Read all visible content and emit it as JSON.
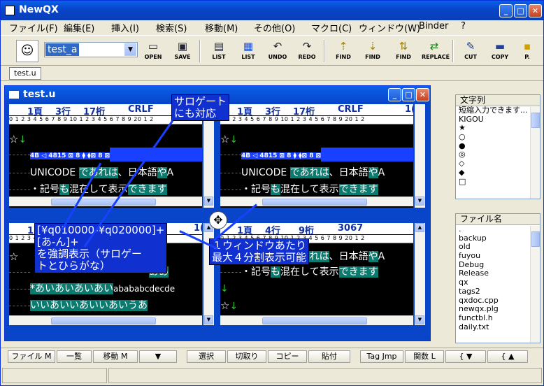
{
  "app": {
    "title": "NewQX"
  },
  "menu": [
    "ファイル(F)",
    "編集(E)",
    "挿入(I)",
    "検索(S)",
    "移動(M)",
    "その他(O)",
    "マクロ(C)",
    "ウィンドウ(W)",
    "Binder",
    "?"
  ],
  "toolbar": {
    "search_value": "test_a",
    "buttons": [
      {
        "label": "OPEN",
        "icon": "open-icon"
      },
      {
        "label": "SAVE",
        "icon": "save-icon"
      },
      {
        "label": "LIST",
        "icon": "list-icon"
      },
      {
        "label": "LIST",
        "icon": "list-multi-icon"
      },
      {
        "label": "UNDO",
        "icon": "undo-icon"
      },
      {
        "label": "REDO",
        "icon": "redo-icon"
      },
      {
        "label": "FIND",
        "icon": "find-up-icon"
      },
      {
        "label": "FIND",
        "icon": "find-down-icon"
      },
      {
        "label": "FIND",
        "icon": "find-icon"
      },
      {
        "label": "REPLACE",
        "icon": "replace-icon"
      },
      {
        "label": "CUT",
        "icon": "cut-icon"
      },
      {
        "label": "COPY",
        "icon": "copy-icon"
      },
      {
        "label": "P.",
        "icon": "paste-icon"
      }
    ]
  },
  "tabs": [
    "test.u"
  ],
  "doc": {
    "title": "test.u",
    "panes": [
      {
        "page": "1頁",
        "line": "3行",
        "col": "17桁",
        "extra": "CRLF",
        "edge": "1("
      },
      {
        "page": "1頁",
        "line": "3行",
        "col": "17桁",
        "extra": "CRLF",
        "edge": "1("
      },
      {
        "page": "1頁",
        "line": "3行",
        "col": "17桁",
        "extra": "",
        "edge": "1("
      },
      {
        "page": "1頁",
        "line": "4行",
        "col": "9桁",
        "extra": "3067",
        "edge": "1("
      }
    ],
    "ruler": "0 1 2 3 4 5 6 7 8 9 10 1 2 3 4 5 6 7 8 9 20 1 2",
    "lines": {
      "unicode_a": "UNICODE",
      "unicode_b": "であれは",
      "unicode_c": "日本語",
      "unicode_d": "や",
      "unicode_e": "A",
      "kigo_a": "・記号",
      "kigo_b": "も",
      "kigo_c": "混在して表示",
      "kigo_d": "できます",
      "surrogate_codes": "4B ◁ 4815 ⊠ 8 ⧫ ⧫⊠ 8 ⊠",
      "hiragana_1": "ああ",
      "hiragana_2": "*あいあいあいあい",
      "hiragana_2b": "abababcdecde",
      "hiragana_3": "いいあいいあいいあいうあ",
      "star": "☆"
    },
    "callouts": {
      "surrogate": "サロゲート\nにも対応",
      "range": "[¥q010000-¥q020000]+\n[あ-ん]+\nを強調表示（サロゲー\nトとひらがな）",
      "split": "１ウィンドウあたり\n最大４分割表示可能"
    }
  },
  "side_top": {
    "header": "文字列",
    "items": [
      "短縮入力できます...",
      "KIGOU",
      "★",
      "○",
      "●",
      "◎",
      "◇",
      "◆",
      "□"
    ]
  },
  "side_bottom": {
    "header": "ファイル名",
    "items": [
      ".",
      "backup",
      "old",
      "fuyou",
      "Debug",
      "Release",
      "qx",
      "tags2",
      "qxdoc.cpp",
      "newqx.plg",
      "functbl.h",
      "daily.txt"
    ]
  },
  "fkeys": [
    "ファイル M",
    "一覧",
    "移動 M",
    "▼",
    "選択",
    "切取り",
    "コピー",
    "貼付",
    "Tag Jmp",
    "関数 L",
    "{ ▼",
    "{ ▲"
  ]
}
